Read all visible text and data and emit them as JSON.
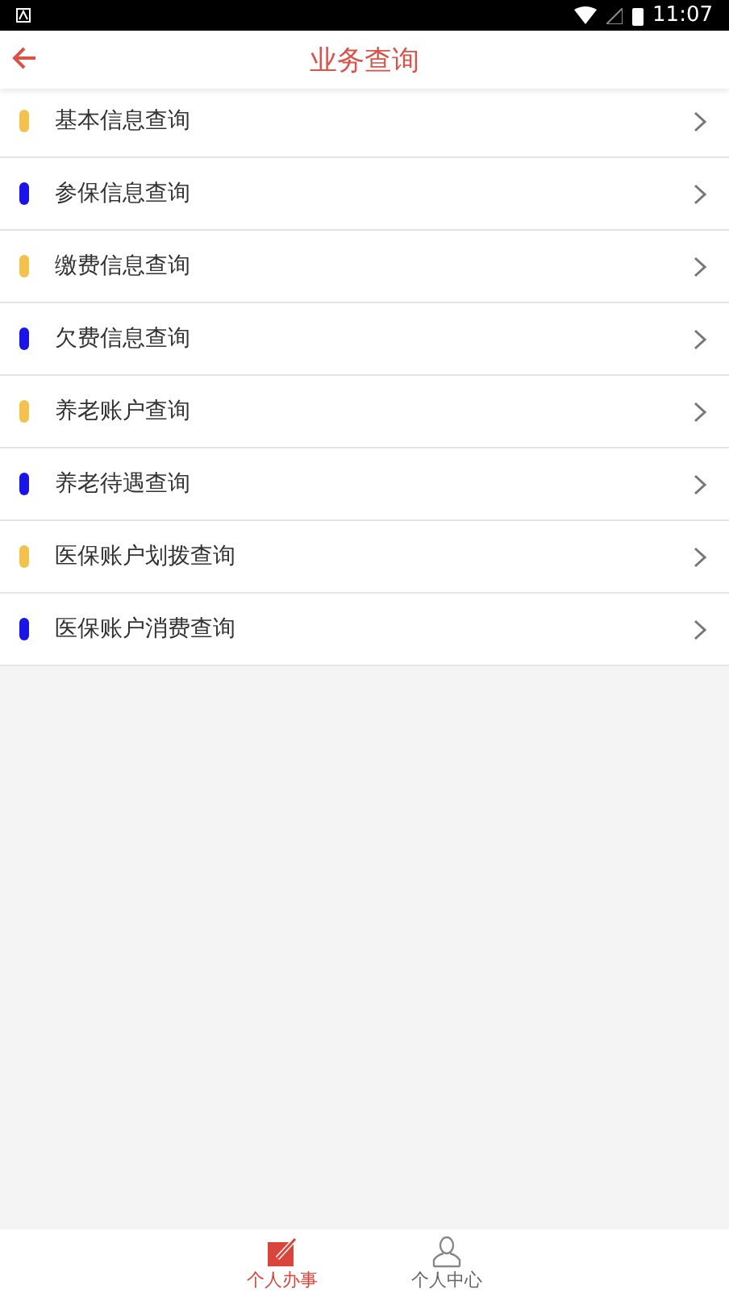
{
  "status_bar": {
    "time": "11:07"
  },
  "header": {
    "title": "业务查询"
  },
  "items": [
    {
      "label": "基本信息查询",
      "color": "#f2c14e"
    },
    {
      "label": "参保信息查询",
      "color": "#1a14e6"
    },
    {
      "label": "缴费信息查询",
      "color": "#f2c14e"
    },
    {
      "label": "欠费信息查询",
      "color": "#1a14e6"
    },
    {
      "label": "养老账户查询",
      "color": "#f2c14e"
    },
    {
      "label": "养老待遇查询",
      "color": "#1a14e6"
    },
    {
      "label": "医保账户划拨查询",
      "color": "#f2c14e"
    },
    {
      "label": "医保账户消费查询",
      "color": "#1a14e6"
    }
  ],
  "tabs": [
    {
      "label": "个人办事",
      "kind": "task",
      "selected": true
    },
    {
      "label": "个人中心",
      "kind": "person",
      "selected": false
    }
  ]
}
